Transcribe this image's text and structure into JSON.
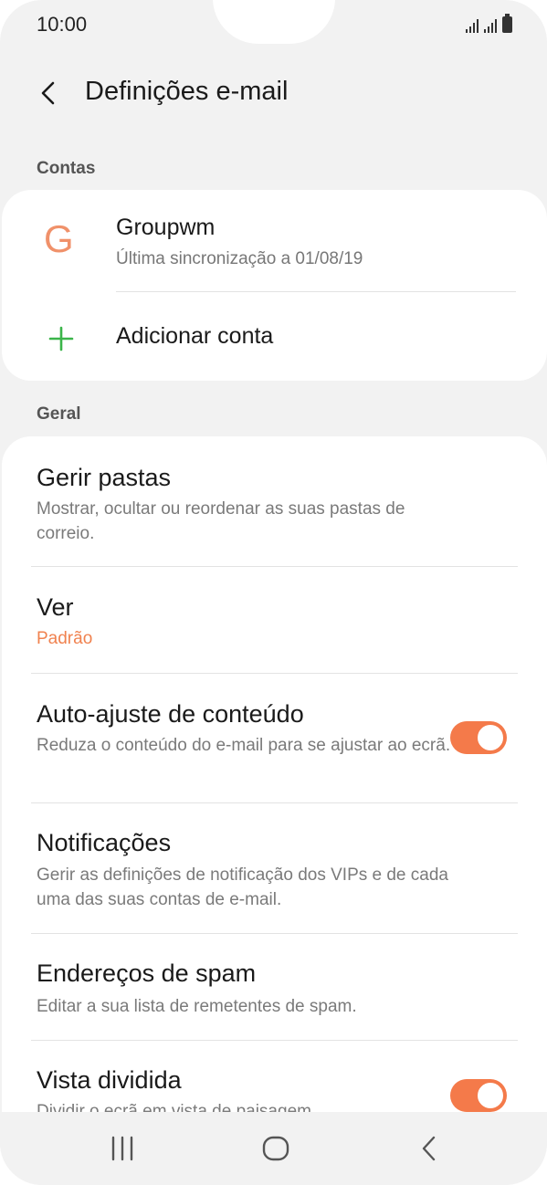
{
  "status_bar": {
    "time": "10:00"
  },
  "header": {
    "title": "Definições e-mail"
  },
  "accounts_section": {
    "label": "Contas",
    "account": {
      "initial": "G",
      "name": "Groupwm",
      "sync": "Última sincronização a 01/08/19"
    },
    "add_label": "Adicionar conta"
  },
  "general_section": {
    "label": "Geral",
    "items": [
      {
        "title": "Gerir pastas",
        "desc": "Mostrar, ocultar ou reordenar as suas pastas de correio."
      },
      {
        "title": "Ver",
        "value": "Padrão"
      },
      {
        "title": "Auto-ajuste de conteúdo",
        "desc": "Reduza o conteúdo do e-mail para se ajustar ao ecrã.",
        "toggle": "on"
      },
      {
        "title": "Notificações",
        "desc": "Gerir as definições de notificação dos VIPs e de cada uma das suas contas de e-mail."
      },
      {
        "title": "Endereços de spam",
        "desc": "Editar a sua lista de remetentes de spam."
      },
      {
        "title": "Vista dividida",
        "desc": "Dividir o ecrã em vista de paisagem.",
        "toggle": "on"
      }
    ]
  },
  "colors": {
    "accent": "#f47a4a",
    "account_icon": "#f0916a",
    "add_icon": "#3bb54a",
    "value_text": "#f0824f"
  },
  "icons": {
    "back": "chevron-left-icon",
    "add": "plus-icon",
    "recents": "recents-icon",
    "home": "home-icon",
    "nav_back": "nav-back-icon"
  }
}
